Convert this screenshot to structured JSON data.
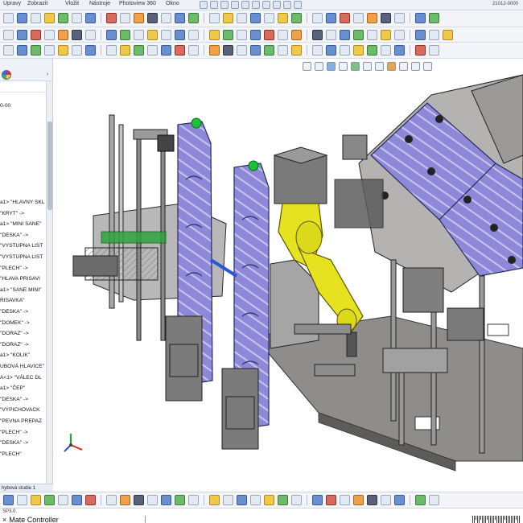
{
  "menu": {
    "items": [
      "Úpravy",
      "Zobrazit",
      "Vložit",
      "Nástroje",
      "Photoview 360",
      "Okno"
    ],
    "title_fragment": "21012-0000"
  },
  "tree": {
    "root_fragment": "0-00",
    "items": [
      "a1> \"HLAVNY SKL",
      "\"KRYT\" ->",
      "a1> \"MINI SANE\"",
      "\"DESKA\" ->",
      "\"VYSTUPNA LIST",
      "\"VYSTUPNA LIST",
      "\"PLECH\" ->",
      "\"HLAVA PRISAVI",
      "a1> \"SANE MINI\"",
      "RISAVKA\"",
      "\"DESKA\" ->",
      "\"DOMEK\" ->",
      "\"DORAZ\" ->",
      "\"DORAZ\" ->",
      "a1> \"KOLIK\"",
      "UBOVÁ HLAVICE\"",
      "A<1> \"VÁLEC DL",
      "a1> \"ČEP\"",
      "\"DESKA\" ->",
      "\"VYPICHOVACK",
      "\"PEVNA PREPAZ",
      "\"PLECH\" ->",
      "\"DESKA\" ->",
      "\"PLECH\""
    ],
    "bottom_tab": "hybová studie 1"
  },
  "status": {
    "version_fragment": "SP3.0",
    "mate_controller_label": "Mate Controller",
    "close_glyph": "×"
  },
  "icons": {
    "tree_tab_1": "feature-manager-icon",
    "tree_tab_2": "appearance-icon",
    "triad": "coordinate-triad-icon"
  },
  "colors": {
    "robot_yellow": "#e6e21f",
    "panel_purple": "#8b86d6",
    "frame_gray": "#9a9a9a",
    "indicator_green": "#1fbf3a",
    "cable_blue": "#2a55d8"
  }
}
